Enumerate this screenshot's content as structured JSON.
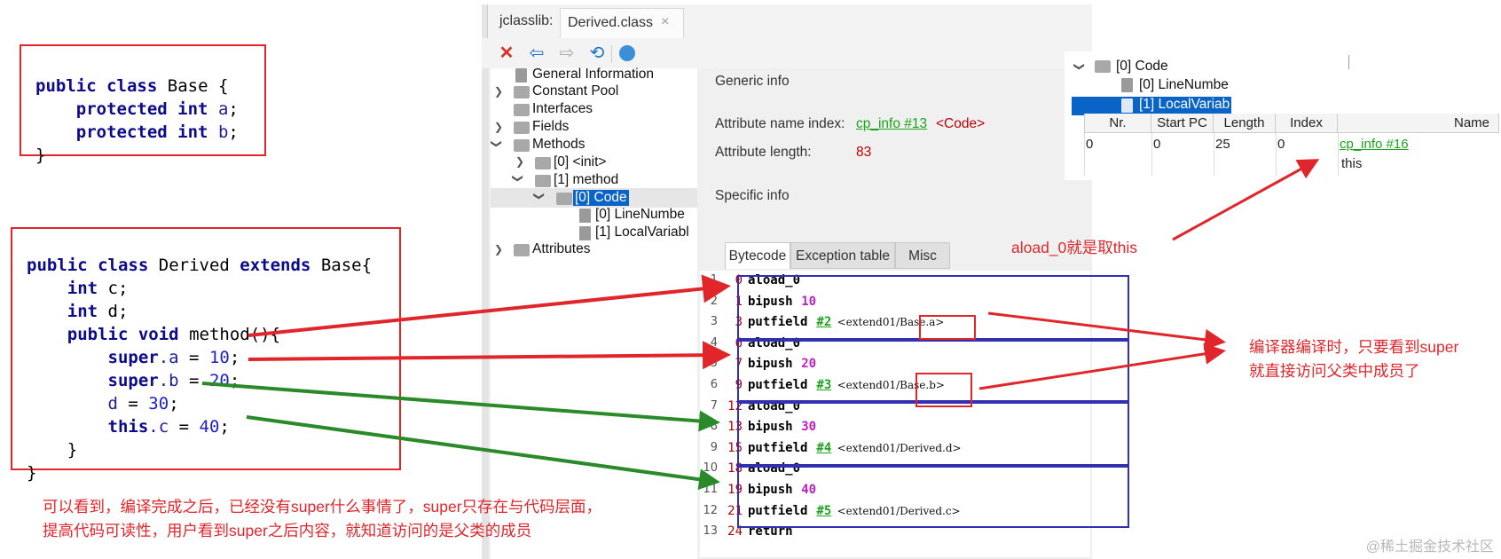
{
  "base_code": {
    "line1": [
      "public",
      "class",
      "Base",
      "{"
    ],
    "line2": [
      "protected",
      "int",
      "a",
      ";"
    ],
    "line3": [
      "protected",
      "int",
      "b",
      ";"
    ],
    "line4": "}"
  },
  "derived_code": {
    "l1_kw1": "public",
    "l1_kw2": "class",
    "l1_name": "Derived",
    "l1_kw3": "extends",
    "l1_base": "Base{",
    "l2_kw": "int",
    "l2_rest": "c;",
    "l3_kw": "int",
    "l3_rest": "d;",
    "l4_kw1": "public",
    "l4_kw2": "void",
    "l4_rest": "method(){",
    "l5_kw": "super",
    "l5_fld": ".a",
    "l5_eq": " = ",
    "l5_num": "10",
    "l5_end": ";",
    "l6_kw": "super",
    "l6_fld": ".b",
    "l6_eq": " = ",
    "l6_num": "20",
    "l6_end": ";",
    "l7_fld": "d",
    "l7_eq": " = ",
    "l7_num": "30",
    "l7_end": ";",
    "l8_kw": "this",
    "l8_fld": ".c",
    "l8_eq": " = ",
    "l8_num": "40",
    "l8_end": ";",
    "l9": "}",
    "l10": "}"
  },
  "window": {
    "tab_app": "jclasslib:",
    "tab_file": "Derived.class",
    "tab_close": "×",
    "toolbar_icons": [
      "close-icon",
      "back-icon",
      "forward-icon",
      "refresh-icon",
      "web-icon"
    ]
  },
  "tree": {
    "general": "General Information",
    "constant_pool": "Constant Pool",
    "interfaces": "Interfaces",
    "fields": "Fields",
    "methods": "Methods",
    "init": "[0] <init>",
    "method": "[1] method",
    "code": "[0] Code",
    "line_number": "[0] LineNumbe",
    "local_var": "[1] LocalVariabl",
    "attributes": "Attributes"
  },
  "info": {
    "generic_title": "Generic info",
    "attr_name_label": "Attribute name index:",
    "attr_name_link": "cp_info #13",
    "attr_name_value": "<Code>",
    "attr_len_label": "Attribute length:",
    "attr_len_value": "83",
    "specific_title": "Specific info",
    "tabs": [
      "Bytecode",
      "Exception table",
      "Misc"
    ]
  },
  "bytecode": [
    {
      "line": "1",
      "off": "0",
      "op": "aload_0",
      "arg": "",
      "cmt": ""
    },
    {
      "line": "2",
      "off": "1",
      "op": "bipush",
      "arg": "10",
      "cmt": ""
    },
    {
      "line": "3",
      "off": "3",
      "op": "putfield",
      "arg": "#2",
      "cmt": "<extend01/Base.a>"
    },
    {
      "line": "4",
      "off": "6",
      "op": "aload_0",
      "arg": "",
      "cmt": ""
    },
    {
      "line": "5",
      "off": "7",
      "op": "bipush",
      "arg": "20",
      "cmt": ""
    },
    {
      "line": "6",
      "off": "9",
      "op": "putfield",
      "arg": "#3",
      "cmt": "<extend01/Base.b>"
    },
    {
      "line": "7",
      "off": "12",
      "op": "aload_0",
      "arg": "",
      "cmt": ""
    },
    {
      "line": "8",
      "off": "13",
      "op": "bipush",
      "arg": "30",
      "cmt": ""
    },
    {
      "line": "9",
      "off": "15",
      "op": "putfield",
      "arg": "#4",
      "cmt": "<extend01/Derived.d>"
    },
    {
      "line": "10",
      "off": "18",
      "op": "aload_0",
      "arg": "",
      "cmt": ""
    },
    {
      "line": "11",
      "off": "19",
      "op": "bipush",
      "arg": "40",
      "cmt": ""
    },
    {
      "line": "12",
      "off": "21",
      "op": "putfield",
      "arg": "#5",
      "cmt": "<extend01/Derived.c>"
    },
    {
      "line": "13",
      "off": "24",
      "op": "return",
      "arg": "",
      "cmt": ""
    }
  ],
  "mini_tree": {
    "code": "[0] Code",
    "line_number": "[0] LineNumbe",
    "local_var": "[1] LocalVariab"
  },
  "lv_table": {
    "headers": [
      "Nr.",
      "Start PC",
      "Length",
      "Index",
      "Name"
    ],
    "row": [
      "0",
      "0",
      "25",
      "0"
    ],
    "name_link": "cp_info #16",
    "name_value": "this"
  },
  "notes": {
    "aload": "aload_0就是取this",
    "compiler_line1": "编译器编译时，只要看到super",
    "compiler_line2": "就直接访问父类中成员了",
    "bottom_line1": "可以看到，编译完成之后，已经没有super什么事情了，super只存在与代码层面，",
    "bottom_line2": "提高代码可读性，用户看到super之后内容，就知道访问的是父类的成员"
  },
  "colors": {
    "annotation_red": "#e0262b",
    "arrow_green": "#2a8a2a",
    "group_box_blue": "#3030b0",
    "selection_blue": "#0a64c8",
    "link_green": "#1aa51a"
  },
  "watermark": "@稀土掘金技术社区"
}
